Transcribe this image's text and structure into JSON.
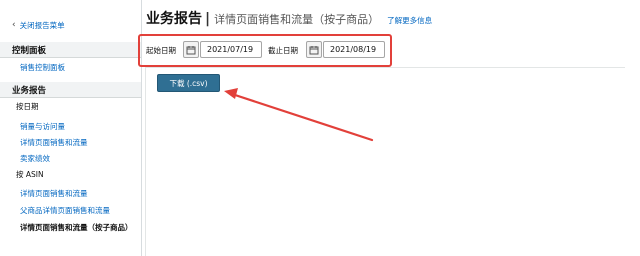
{
  "sidebar": {
    "close_label": "关闭报告菜单",
    "dashboards": {
      "title": "控制面板",
      "items": [
        "销售控制面板"
      ]
    },
    "reports": {
      "title": "业务报告",
      "by_date_header": "按日期",
      "by_date_items": [
        "销量与访问量",
        "详情页面销售和流量",
        "卖家绩效"
      ],
      "by_asin_header": "按 ASIN",
      "by_asin_items": [
        "详情页面销售和流量",
        "父商品详情页面销售和流量"
      ],
      "current_item": "详情页面销售和流量（按子商品）"
    }
  },
  "header": {
    "title": "业务报告",
    "separator": "|",
    "subtitle": "详情页面销售和流量（按子商品）",
    "learn_more": "了解更多信息"
  },
  "date_filter": {
    "start_label": "起始日期",
    "start_value": "2021/07/19",
    "end_label": "截止日期",
    "end_value": "2021/08/19"
  },
  "actions": {
    "download_label": "下载 (.csv)"
  },
  "colors": {
    "highlight": "#e2403a",
    "link": "#0066c0",
    "button": "#2f6f93"
  },
  "icons": {
    "close": "chevron-left-icon",
    "calendar": "calendar-icon",
    "annotation": "arrow-icon"
  }
}
